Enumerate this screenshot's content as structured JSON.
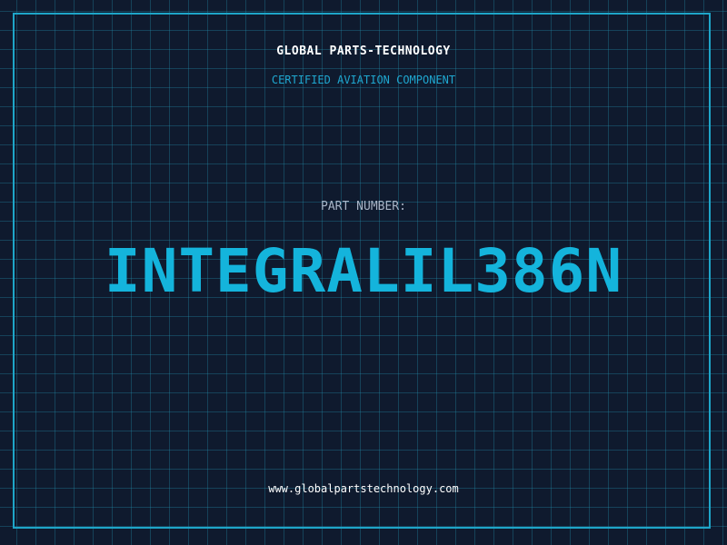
{
  "company": {
    "name": "GLOBAL PARTS-TECHNOLOGY",
    "tagline": "CERTIFIED AVIATION COMPONENT"
  },
  "part": {
    "label": "PART NUMBER:",
    "number": "INTEGRALIL386N"
  },
  "footer": {
    "website": "www.globalpartstechnology.com"
  },
  "colors": {
    "background": "#0f1a2e",
    "accent": "#14b4dc",
    "grid": "#228caa"
  }
}
